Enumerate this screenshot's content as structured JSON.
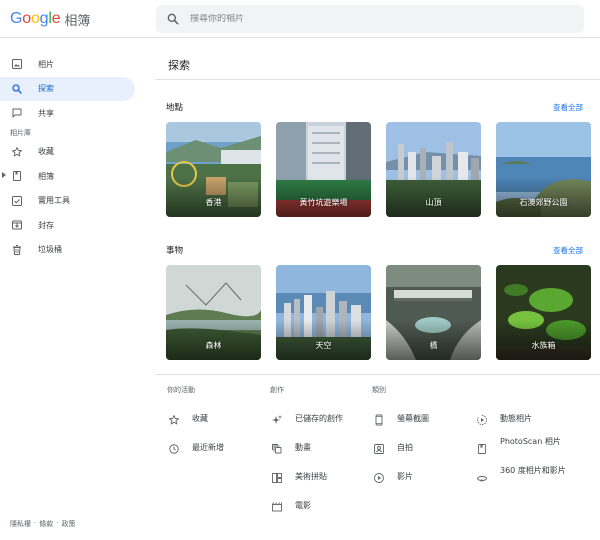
{
  "header": {
    "logo_letters": [
      "G",
      "o",
      "o",
      "g",
      "l",
      "e"
    ],
    "logo_colors": [
      "#4285f4",
      "#ea4335",
      "#fbbc05",
      "#4285f4",
      "#34a853",
      "#ea4335"
    ],
    "product": "相簿",
    "search_placeholder": "搜尋你的相片"
  },
  "sidebar": {
    "items": [
      {
        "label": "相片",
        "icon": "photo-icon"
      },
      {
        "label": "探索",
        "icon": "search-icon",
        "active": true
      },
      {
        "label": "共享",
        "icon": "chat-icon"
      }
    ],
    "section_label": "相片庫",
    "library": [
      {
        "label": "收藏",
        "icon": "star-icon"
      },
      {
        "label": "相簿",
        "icon": "album-icon"
      },
      {
        "label": "實用工具",
        "icon": "checklist-icon"
      },
      {
        "label": "封存",
        "icon": "archive-icon"
      },
      {
        "label": "垃圾桶",
        "icon": "trash-icon"
      }
    ]
  },
  "footer": {
    "privacy": "隱私權",
    "terms": "條款",
    "policies": "政策",
    "separator": "·"
  },
  "main": {
    "title": "探索",
    "places": {
      "title": "地點",
      "see_all": "查看全部",
      "cards": [
        {
          "label": "香港"
        },
        {
          "label": "黃竹坑遊樂場"
        },
        {
          "label": "山頂"
        },
        {
          "label": "石澳郊野公園"
        }
      ]
    },
    "things": {
      "title": "事物",
      "see_all": "查看全部",
      "cards": [
        {
          "label": "森林"
        },
        {
          "label": "天空"
        },
        {
          "label": "橋"
        },
        {
          "label": "水族箱"
        }
      ]
    },
    "activity": {
      "title": "你的活動",
      "items": [
        {
          "label": "收藏",
          "icon": "star-icon"
        },
        {
          "label": "最近新增",
          "icon": "clock-icon"
        }
      ]
    },
    "creations": {
      "title": "創作",
      "items": [
        {
          "label": "已儲存的創作",
          "icon": "sparkle-icon"
        },
        {
          "label": "動畫",
          "icon": "animation-icon"
        },
        {
          "label": "美術拼貼",
          "icon": "collage-icon"
        },
        {
          "label": "電影",
          "icon": "movie-icon"
        }
      ]
    },
    "categories": {
      "title": "類別",
      "items_left": [
        {
          "label": "螢幕截圖",
          "icon": "phone-icon"
        },
        {
          "label": "自拍",
          "icon": "selfie-icon"
        },
        {
          "label": "影片",
          "icon": "play-icon"
        }
      ],
      "items_right": [
        {
          "label": "動態相片",
          "icon": "motion-icon"
        },
        {
          "label": "PhotoScan 相片",
          "icon": "photoscan-icon"
        },
        {
          "label": "360 度相片和影片",
          "icon": "360-icon"
        }
      ]
    }
  }
}
